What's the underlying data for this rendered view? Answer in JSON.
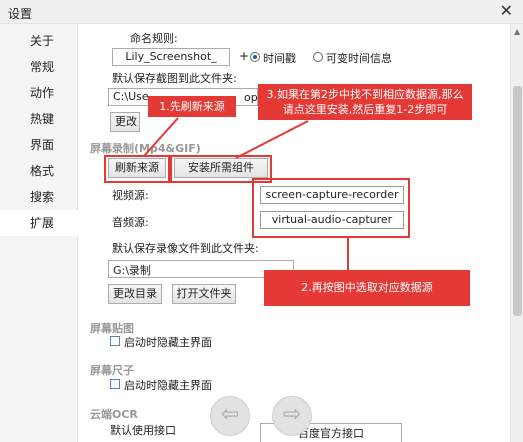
{
  "window": {
    "title": "设置",
    "close": "✕"
  },
  "sidebar": {
    "items": [
      "关于",
      "常规",
      "动作",
      "热键",
      "界面",
      "格式",
      "搜索",
      "扩展"
    ]
  },
  "screenshot": {
    "naming_label": "命名规则:",
    "naming_value": "Lily_Screenshot_",
    "plus": "+",
    "radio_timestamp": "时间戳",
    "radio_custom": "可变时间信息",
    "save_dir_label": "默认保存截图到此文件夹:",
    "save_dir_value": "C:\\Use",
    "save_dir_tail": "op",
    "change_dir_partial": "更改"
  },
  "record": {
    "section_title": "屏幕录制(Mp4&GIF)",
    "refresh_button": "刷新来源",
    "install_button": "安装所需组件",
    "video_label": "视频源:",
    "video_value": "screen-capture-recorder",
    "audio_label": "音频源:",
    "audio_value": "virtual-audio-capturer",
    "save_dir_label": "默认保存录像文件到此文件夹:",
    "save_dir_value": "G:\\录制",
    "change_dir_button": "更改目录",
    "open_dir_button": "打开文件夹"
  },
  "pin": {
    "section_title": "屏幕贴图",
    "hide_main": "启动时隐藏主界面"
  },
  "ruler": {
    "section_title": "屏幕尺子",
    "hide_main": "启动时隐藏主界面"
  },
  "ocr": {
    "section_title": "云端OCR",
    "default_api_label": "默认使用接口",
    "api_value": "百度官方接口"
  },
  "annotations": {
    "step1": "1.先刷新来源",
    "step2": "2.再按图中选取对应数据源",
    "step3": "3.如果在第2步中找不到相应数据源,那么请点这里安装,然后重复1-2步即可"
  },
  "nav": {
    "prev": "⇦",
    "next": "⇨"
  },
  "colors": {
    "annotation": "#e53935",
    "section_title": "#999999"
  }
}
